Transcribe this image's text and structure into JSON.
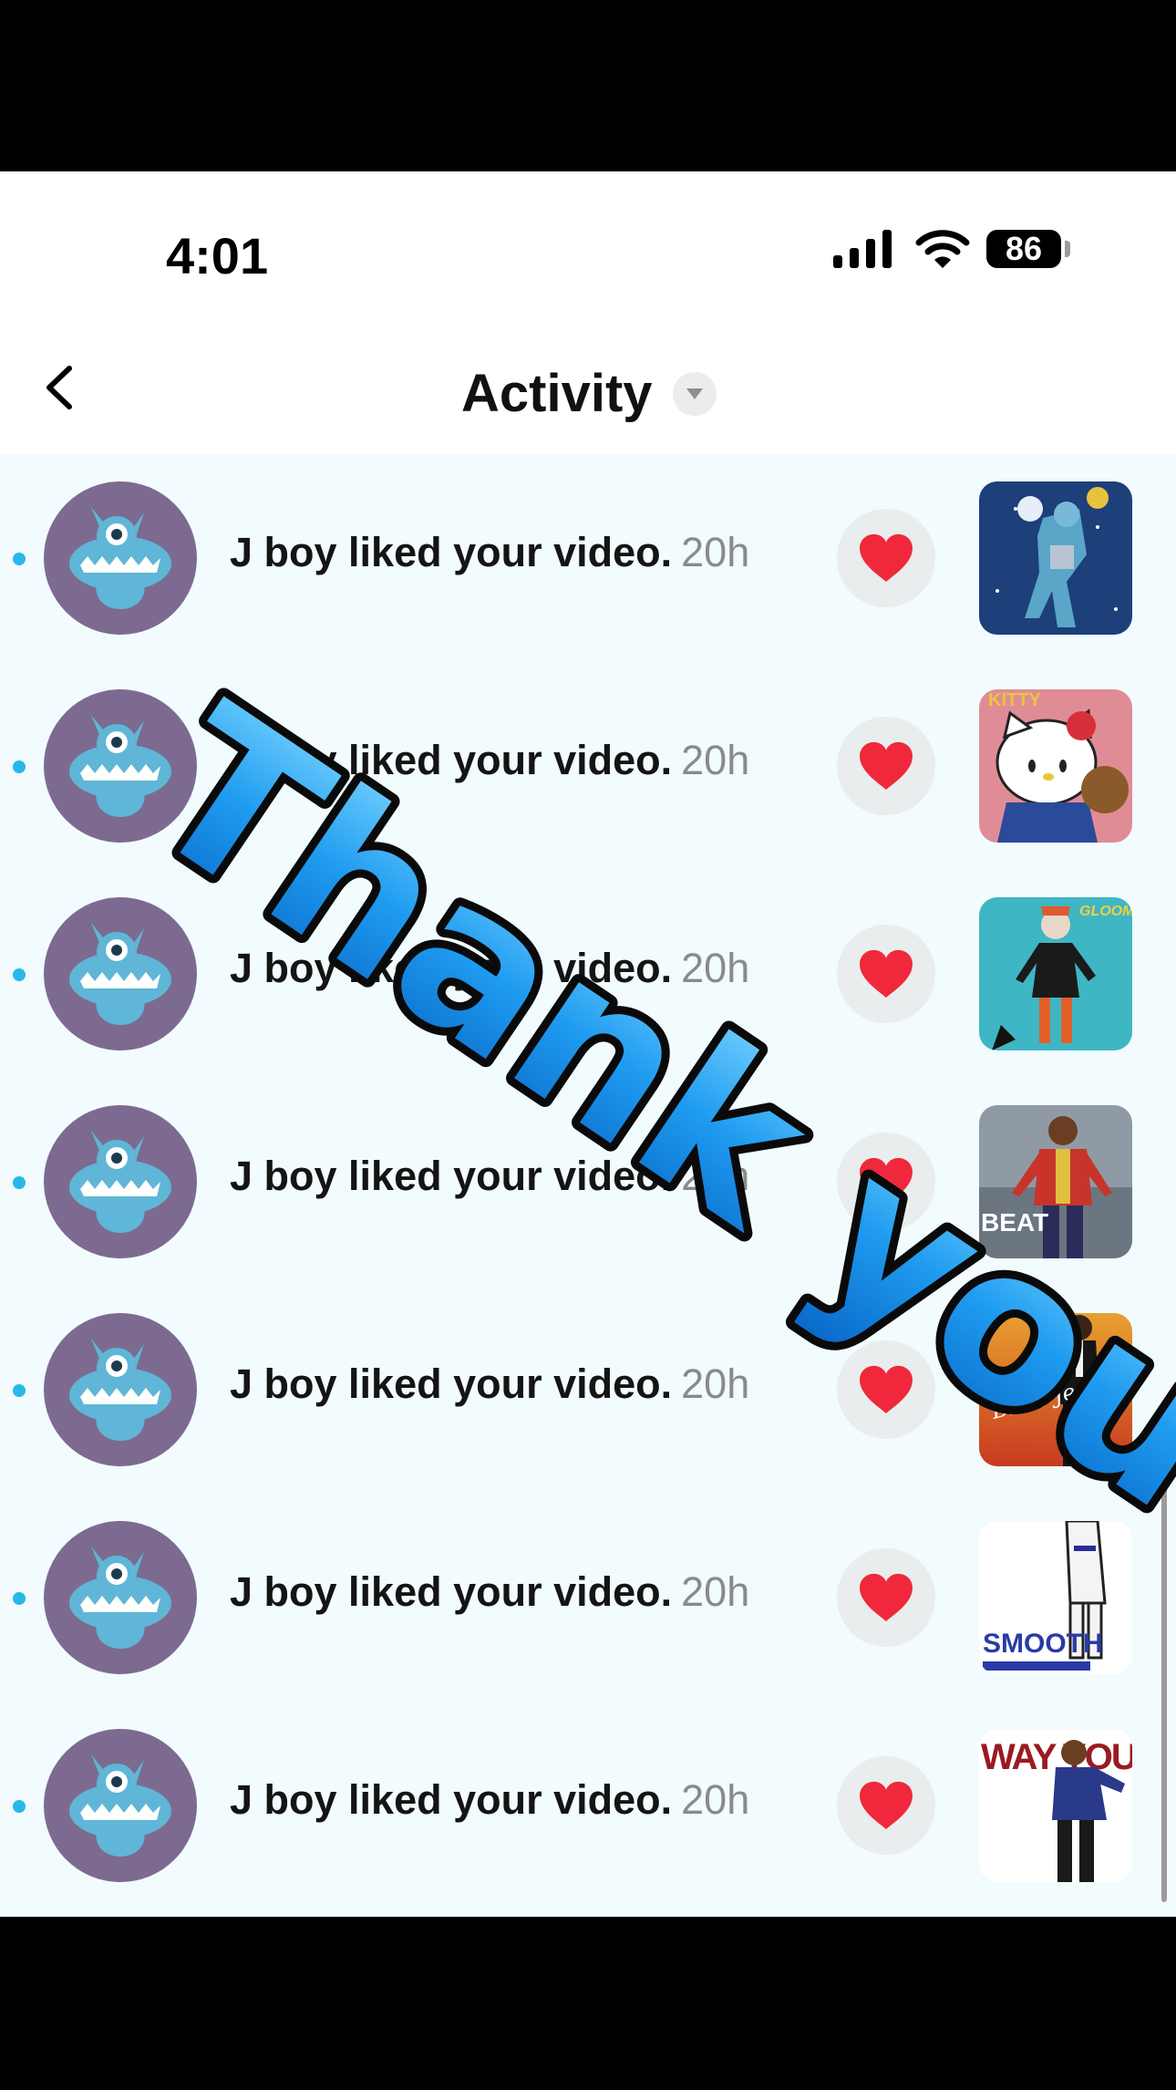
{
  "status_bar": {
    "time": "4:01",
    "battery": "86",
    "icons": [
      "cellular-signal-icon",
      "wifi-icon",
      "battery-icon"
    ]
  },
  "header": {
    "title": "Activity",
    "back_icon": "chevron-left-icon",
    "dropdown_icon": "caret-down-icon"
  },
  "notifications": [
    {
      "text": "J boy liked your video.",
      "time": "20h",
      "thumbnail": "robot-figure-thumbnail"
    },
    {
      "text": "J boy liked your video.",
      "time": "20h",
      "thumbnail": "hello-kitty-thumbnail"
    },
    {
      "text": "J boy liked your video.",
      "time": "20h",
      "thumbnail": "gloom-character-thumbnail"
    },
    {
      "text": "J boy liked your video.",
      "time": "20h",
      "thumbnail": "beat-it-thumbnail"
    },
    {
      "text": "J boy liked your video.",
      "time": "20h",
      "thumbnail": "billie-jean-thumbnail"
    },
    {
      "text": "J boy liked your video.",
      "time": "20h",
      "thumbnail": "smooth-criminal-thumbnail"
    },
    {
      "text": "J boy liked your video.",
      "time": "20h",
      "thumbnail": "the-way-you-make-me-feel-thumbnail"
    }
  ],
  "thumbnail_labels": {
    "kitty": "KITTY",
    "gloom": "GLOOM",
    "beat": "BEAT",
    "billie": "Billie Jean",
    "smooth": "SMOOTH",
    "way": "WAY YOU MAKE ME FEEL"
  },
  "overlay": {
    "text": "Thank you",
    "color": "#1e9bf0"
  },
  "colors": {
    "accent_dot": "#28b8e8",
    "heart": "#f0283c",
    "avatar_bg": "#7d6a91",
    "avatar_monster": "#5fb6d6"
  }
}
